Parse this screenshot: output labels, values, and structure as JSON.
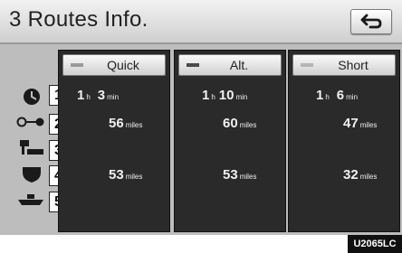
{
  "header": {
    "title": "3 Routes Info."
  },
  "back_button": {
    "icon": "return-arrow-icon"
  },
  "routes": [
    {
      "label": "Quick"
    },
    {
      "label": "Alt."
    },
    {
      "label": "Short"
    }
  ],
  "rows": [
    {
      "number": "1",
      "icon": "clock-icon"
    },
    {
      "number": "2",
      "icon": "distance-icon"
    },
    {
      "number": "3",
      "icon": "toll-road-icon"
    },
    {
      "number": "4",
      "icon": "freeway-shield-icon"
    },
    {
      "number": "5",
      "icon": "ferry-icon"
    }
  ],
  "values": {
    "time": [
      {
        "h": "1",
        "h_unit": "h",
        "m": "3",
        "m_unit": "min"
      },
      {
        "h": "1",
        "h_unit": "h",
        "m": "10",
        "m_unit": "min"
      },
      {
        "h": "1",
        "h_unit": "h",
        "m": "6",
        "m_unit": "min"
      }
    ],
    "distance": [
      {
        "value": "56",
        "unit": "miles"
      },
      {
        "value": "60",
        "unit": "miles"
      },
      {
        "value": "47",
        "unit": "miles"
      }
    ],
    "freeway": [
      {
        "value": "53",
        "unit": "miles"
      },
      {
        "value": "53",
        "unit": "miles"
      },
      {
        "value": "32",
        "unit": "miles"
      }
    ]
  },
  "figure_code": "U2065LC"
}
